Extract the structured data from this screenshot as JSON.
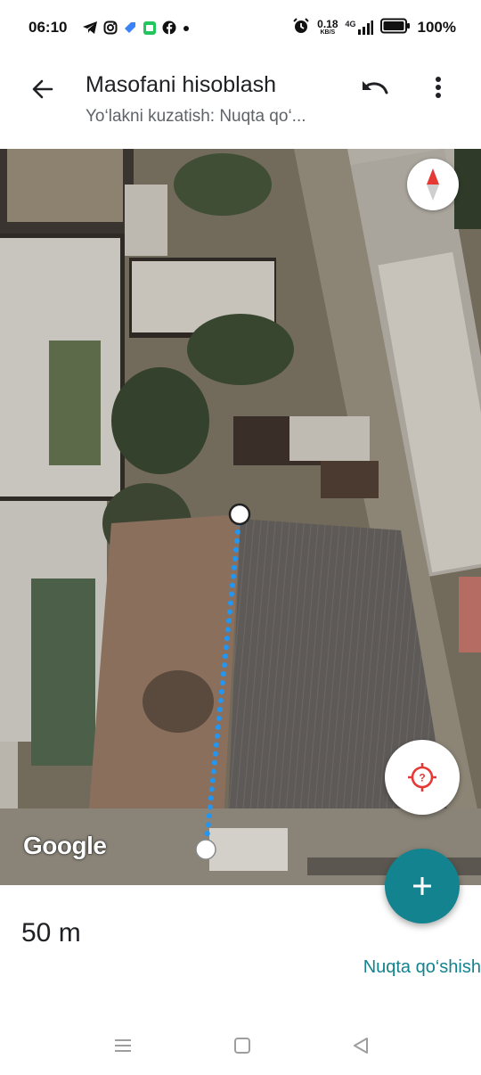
{
  "status_bar": {
    "time": "06:10",
    "net_speed_value": "0.18",
    "net_speed_unit": "KB/S",
    "network_type": "4G",
    "battery_pct": "100%",
    "icons": [
      "telegram-icon",
      "instagram-icon",
      "app-icon",
      "app-icon",
      "facebook-icon",
      "dot-icon",
      "alarm-icon",
      "signal-icon",
      "battery-icon"
    ]
  },
  "app_bar": {
    "title": "Masofani hisoblash",
    "subtitle": "Yo‘lakni kuzatish: Nuqta qo‘...",
    "icons": [
      "back-arrow-icon",
      "undo-icon",
      "more-vert-icon"
    ]
  },
  "map": {
    "attribution": "Google",
    "path_color": "#2196f3",
    "icons": [
      "compass-icon",
      "my-location-icon"
    ]
  },
  "fab": {
    "icon": "plus-icon",
    "color": "#13838f"
  },
  "measurement": {
    "distance": "50 m",
    "add_point_label": "Nuqta qo‘shish"
  },
  "nav_bar": {
    "icons": [
      "recents-icon",
      "home-icon",
      "back-icon"
    ]
  }
}
